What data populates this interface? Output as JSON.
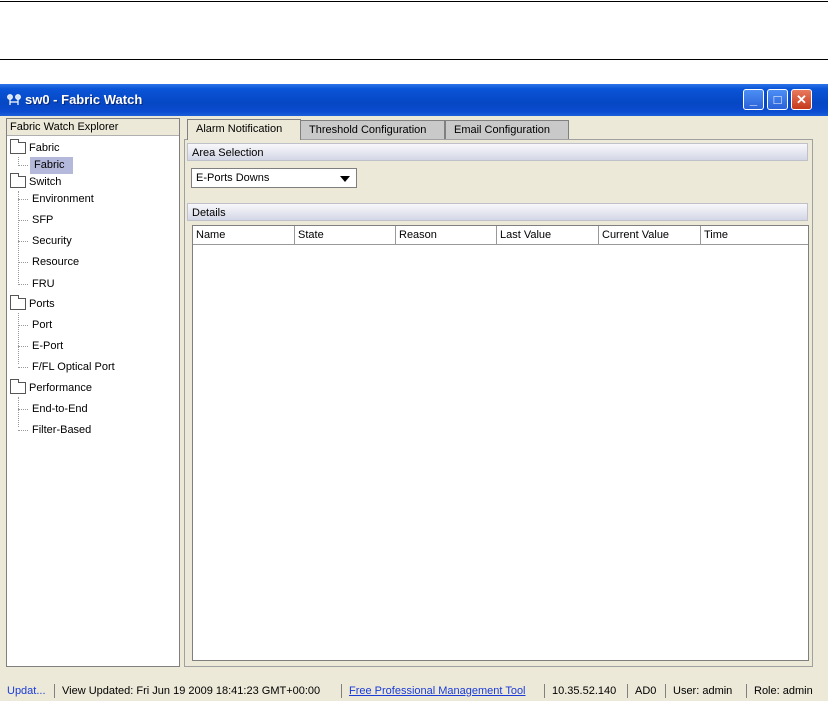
{
  "window": {
    "title": "sw0 - Fabric Watch",
    "controls": {
      "minimize": "_",
      "maximize": "□",
      "close": "✕"
    }
  },
  "explorer": {
    "header": "Fabric Watch Explorer",
    "groups": [
      {
        "label": "Fabric",
        "children": [
          "Fabric"
        ]
      },
      {
        "label": "Switch",
        "children": [
          "Environment",
          "SFP",
          "Security",
          "Resource",
          "FRU"
        ]
      },
      {
        "label": "Ports",
        "children": [
          "Port",
          "E-Port",
          "F/FL Optical Port"
        ]
      },
      {
        "label": "Performance",
        "children": [
          "End-to-End",
          "Filter-Based"
        ]
      }
    ],
    "selected": "Fabric"
  },
  "tabs": [
    "Alarm Notification",
    "Threshold Configuration",
    "Email Configuration"
  ],
  "active_tab": "Alarm Notification",
  "area_selection": {
    "header": "Area Selection",
    "selected_value": "E-Ports Downs"
  },
  "details": {
    "header": "Details",
    "columns": [
      "Name",
      "State",
      "Reason",
      "Last Value",
      "Current Value",
      "Time"
    ]
  },
  "status": {
    "update_link": "Updat...",
    "view_updated": "View Updated: Fri Jun 19 2009 18:41:23 GMT+00:00",
    "mgmt_link": "Free Professional Management Tool",
    "ip": "10.35.52.140",
    "ad": "AD0",
    "user": "User: admin",
    "role": "Role: admin"
  },
  "colors": {
    "titlebar": "#0a55d8",
    "selection": "#b4b9dc",
    "link": "#1a3bd8"
  }
}
